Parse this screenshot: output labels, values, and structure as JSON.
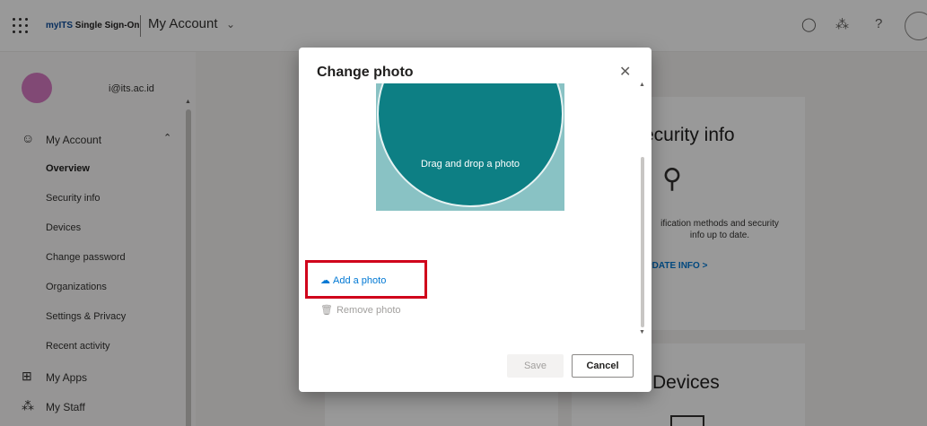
{
  "header": {
    "brand_prefix": "myITS",
    "brand_suffix": " Single Sign-On",
    "app_title": "My Account",
    "icons": [
      "waffle-icon",
      "chevron-down-icon",
      "feedback-icon",
      "org-icon",
      "help-icon",
      "profile-avatar"
    ]
  },
  "profile": {
    "email": "i@its.ac.id",
    "avatar_color": "#d77bc3"
  },
  "sidebar": {
    "section_label": "My Account",
    "items": [
      {
        "label": "Overview"
      },
      {
        "label": "Security info"
      },
      {
        "label": "Devices"
      },
      {
        "label": "Change password"
      },
      {
        "label": "Organizations"
      },
      {
        "label": "Settings & Privacy"
      },
      {
        "label": "Recent activity"
      }
    ],
    "my_apps": "My Apps",
    "my_staff": "My Staff"
  },
  "cards": {
    "security_info": {
      "title": "ecurity info",
      "text_line1": "ification methods and security",
      "text_line2": "info up to date.",
      "link": "PDATE INFO >"
    },
    "devices": {
      "title": "Devices"
    }
  },
  "modal": {
    "title": "Change photo",
    "drop_label": "Drag and drop a photo",
    "add_photo": "Add a photo",
    "remove_photo": "Remove photo",
    "save_label": "Save",
    "cancel_label": "Cancel"
  },
  "colors": {
    "accent": "#0078d4",
    "photo_circle": "#0d7f84",
    "photo_background": "#89c2c4",
    "highlight_box": "#d0021b"
  }
}
